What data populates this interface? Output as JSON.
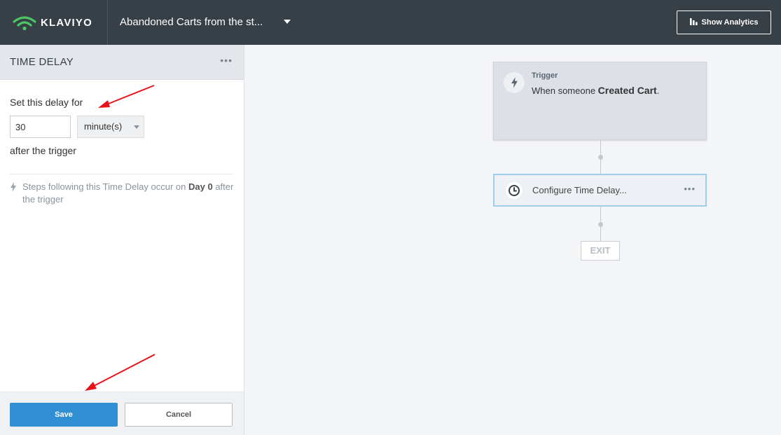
{
  "header": {
    "brand_name": "KLAVIYO",
    "flow_title": "Abandoned Carts from the st...",
    "analytics_label": "Show Analytics"
  },
  "sidebar": {
    "title": "TIME DELAY",
    "more_label": "•••",
    "delay_label": "Set this delay for",
    "delay_value": "30",
    "unit_value": "minute(s)",
    "after_label": "after the trigger",
    "info_prefix": "Steps following this Time Delay occur on ",
    "info_day": "Day 0",
    "info_suffix": " after the trigger",
    "save_label": "Save",
    "cancel_label": "Cancel"
  },
  "canvas": {
    "trigger_kicker": "Trigger",
    "trigger_text_prefix": "When someone ",
    "trigger_event": "Created Cart",
    "trigger_text_suffix": ".",
    "delay_card_label": "Configure Time Delay...",
    "delay_card_more": "•••",
    "exit_label": "EXIT"
  },
  "icons": {
    "brand": "klaviyo-signal-icon",
    "analytics": "bar-chart-icon",
    "info": "lightning-icon",
    "trigger": "lightning-icon",
    "delay": "clock-icon"
  },
  "colors": {
    "topbar": "#373f47",
    "brand_green": "#4cc764",
    "save_button": "#2f8fd2",
    "selected_card_border": "#9fcdec",
    "annotation_arrow": "#e8141c"
  }
}
